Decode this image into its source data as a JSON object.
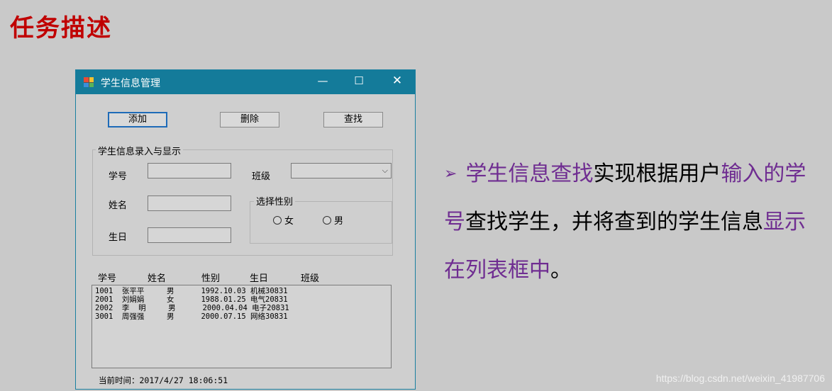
{
  "slide": {
    "title": "任务描述"
  },
  "window": {
    "title": "学生信息管理",
    "minimize_glyph": "—",
    "maximize_glyph": "☐",
    "close_glyph": "✕"
  },
  "toolbar": {
    "add_label": "添加",
    "delete_label": "删除",
    "find_label": "查找"
  },
  "form": {
    "group_title": "学生信息录入与显示",
    "id_label": "学号",
    "name_label": "姓名",
    "birthday_label": "生日",
    "class_label": "班级",
    "gender_group_title": "选择性别",
    "female_label": "女",
    "male_label": "男",
    "id_value": "",
    "name_value": "",
    "birthday_value": "",
    "class_value": ""
  },
  "list": {
    "headers": [
      "学号",
      "姓名",
      "性别",
      "生日",
      "班级"
    ],
    "rows": [
      "1001  张平平     男      1992.10.03 机械30831",
      "2001  刘娟娟     女      1988.01.25 电气20831",
      "2002  李  明     男      2000.04.04 电子20831",
      "3001  周强强     男      2000.07.15 网络30831"
    ]
  },
  "status": {
    "time_text": "当前时间：2017/4/27 18:06:51"
  },
  "description": {
    "part1": "学生信息查找",
    "part2": "实现根据用户",
    "part3": "输入的学号",
    "part4": "查找学生，并将查到的学生信息",
    "part5": "显示在列表框中",
    "part6": "。"
  },
  "watermark": "https://blog.csdn.net/weixin_41987706",
  "colors": {
    "title_red": "#c00000",
    "highlight_purple": "#6f2d91",
    "titlebar": "#147b9a"
  }
}
